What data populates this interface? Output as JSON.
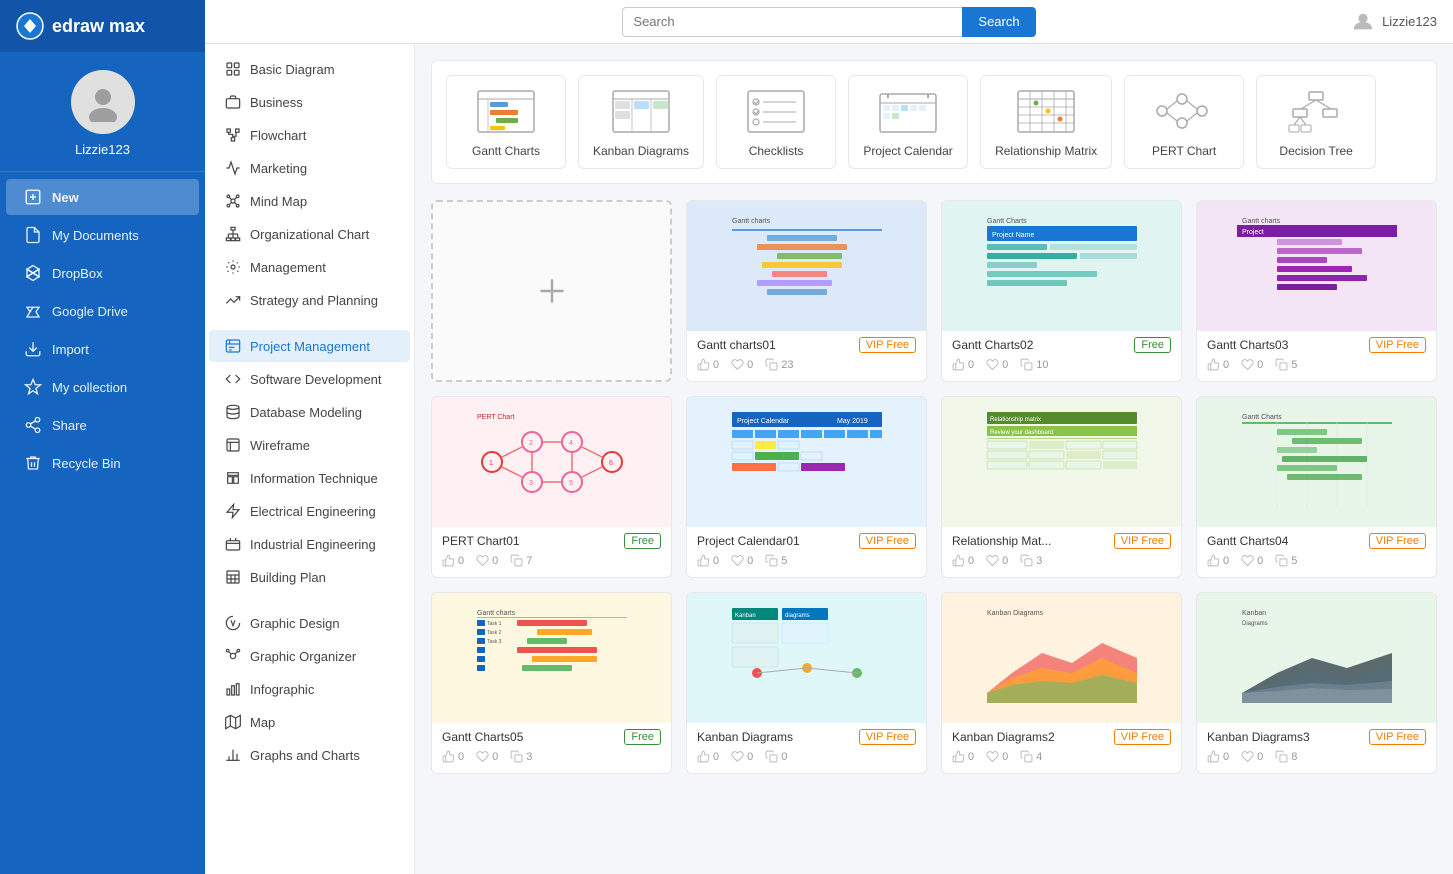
{
  "app": {
    "name": "edraw max"
  },
  "topbar": {
    "search_placeholder": "Search",
    "search_button": "Search",
    "username": "Lizzie123"
  },
  "sidebar": {
    "username": "Lizzie123",
    "items": [
      {
        "id": "new",
        "label": "New",
        "active": true
      },
      {
        "id": "my-documents",
        "label": "My Documents",
        "active": false
      },
      {
        "id": "dropbox",
        "label": "DropBox",
        "active": false
      },
      {
        "id": "google-drive",
        "label": "Google Drive",
        "active": false
      },
      {
        "id": "import",
        "label": "Import",
        "active": false
      },
      {
        "id": "my-collection",
        "label": "My collection",
        "active": false
      },
      {
        "id": "share",
        "label": "Share",
        "active": false
      },
      {
        "id": "recycle-bin",
        "label": "Recycle Bin",
        "active": false
      }
    ]
  },
  "secondary_sidebar": {
    "items": [
      {
        "id": "basic-diagram",
        "label": "Basic Diagram",
        "active": false
      },
      {
        "id": "business",
        "label": "Business",
        "active": false
      },
      {
        "id": "flowchart",
        "label": "Flowchart",
        "active": false
      },
      {
        "id": "marketing",
        "label": "Marketing",
        "active": false
      },
      {
        "id": "mind-map",
        "label": "Mind Map",
        "active": false
      },
      {
        "id": "organizational-chart",
        "label": "Organizational Chart",
        "active": false
      },
      {
        "id": "management",
        "label": "Management",
        "active": false
      },
      {
        "id": "strategy-and-planning",
        "label": "Strategy and Planning",
        "active": false
      },
      {
        "id": "project-management",
        "label": "Project Management",
        "active": true
      },
      {
        "id": "software-development",
        "label": "Software Development",
        "active": false
      },
      {
        "id": "database-modeling",
        "label": "Database Modeling",
        "active": false
      },
      {
        "id": "wireframe",
        "label": "Wireframe",
        "active": false
      },
      {
        "id": "information-technique",
        "label": "Information Technique",
        "active": false
      },
      {
        "id": "electrical-engineering",
        "label": "Electrical Engineering",
        "active": false
      },
      {
        "id": "industrial-engineering",
        "label": "Industrial Engineering",
        "active": false
      },
      {
        "id": "building-plan",
        "label": "Building Plan",
        "active": false
      },
      {
        "id": "graphic-design",
        "label": "Graphic Design",
        "active": false
      },
      {
        "id": "graphic-organizer",
        "label": "Graphic Organizer",
        "active": false
      },
      {
        "id": "infographic",
        "label": "Infographic",
        "active": false
      },
      {
        "id": "map",
        "label": "Map",
        "active": false
      },
      {
        "id": "graphs-and-charts",
        "label": "Graphs and Charts",
        "active": false
      }
    ]
  },
  "template_categories": [
    {
      "id": "gantt-charts",
      "label": "Gantt Charts"
    },
    {
      "id": "kanban-diagrams",
      "label": "Kanban Diagrams"
    },
    {
      "id": "checklists",
      "label": "Checklists"
    },
    {
      "id": "project-calendar",
      "label": "Project Calendar"
    },
    {
      "id": "relationship-matrix",
      "label": "Relationship Matrix"
    },
    {
      "id": "pert-chart",
      "label": "PERT Chart"
    },
    {
      "id": "decision-tree",
      "label": "Decision Tree"
    }
  ],
  "diagrams": [
    {
      "id": "new",
      "type": "new"
    },
    {
      "id": "gantt01",
      "name": "Gantt charts01",
      "badge": "VIP Free",
      "badge_type": "vip",
      "likes": 0,
      "hearts": 0,
      "copies": 23,
      "color": "#e8f0fe"
    },
    {
      "id": "gantt02",
      "name": "Gantt Charts02",
      "badge": "Free",
      "badge_type": "free",
      "likes": 0,
      "hearts": 0,
      "copies": 10,
      "color": "#e8f8f5"
    },
    {
      "id": "gantt03",
      "name": "Gantt Charts03",
      "badge": "VIP Free",
      "badge_type": "vip",
      "likes": 0,
      "hearts": 0,
      "copies": 5,
      "color": "#f3e5f5"
    },
    {
      "id": "pert01",
      "name": "PERT Chart01",
      "badge": "Free",
      "badge_type": "free",
      "likes": 0,
      "hearts": 0,
      "copies": 7,
      "color": "#fce4ec"
    },
    {
      "id": "calendar01",
      "name": "Project Calendar01",
      "badge": "VIP Free",
      "badge_type": "vip",
      "likes": 0,
      "hearts": 0,
      "copies": 5,
      "color": "#e3f2fd"
    },
    {
      "id": "relmatrix01",
      "name": "Relationship Mat...",
      "badge": "VIP Free",
      "badge_type": "vip",
      "likes": 0,
      "hearts": 0,
      "copies": 3,
      "color": "#f1f8e9"
    },
    {
      "id": "gantt04",
      "name": "Gantt Charts04",
      "badge": "VIP Free",
      "badge_type": "vip",
      "likes": 0,
      "hearts": 0,
      "copies": 5,
      "color": "#e8f5e9"
    },
    {
      "id": "gantt05",
      "name": "Gantt Charts05",
      "badge": "Free",
      "badge_type": "free",
      "likes": 0,
      "hearts": 0,
      "copies": 3,
      "color": "#fff8e1"
    },
    {
      "id": "kanban01",
      "name": "Kanban Diagrams",
      "badge": "VIP Free",
      "badge_type": "vip",
      "likes": 0,
      "hearts": 0,
      "copies": 0,
      "color": "#e0f7fa"
    },
    {
      "id": "kanban02",
      "name": "Kanban Diagrams2",
      "badge": "VIP Free",
      "badge_type": "vip",
      "likes": 0,
      "hearts": 0,
      "copies": 4,
      "color": "#fff3e0"
    },
    {
      "id": "kanban03",
      "name": "Kanban Diagrams3",
      "badge": "VIP Free",
      "badge_type": "vip",
      "likes": 0,
      "hearts": 0,
      "copies": 8,
      "color": "#e8f5e9"
    }
  ]
}
